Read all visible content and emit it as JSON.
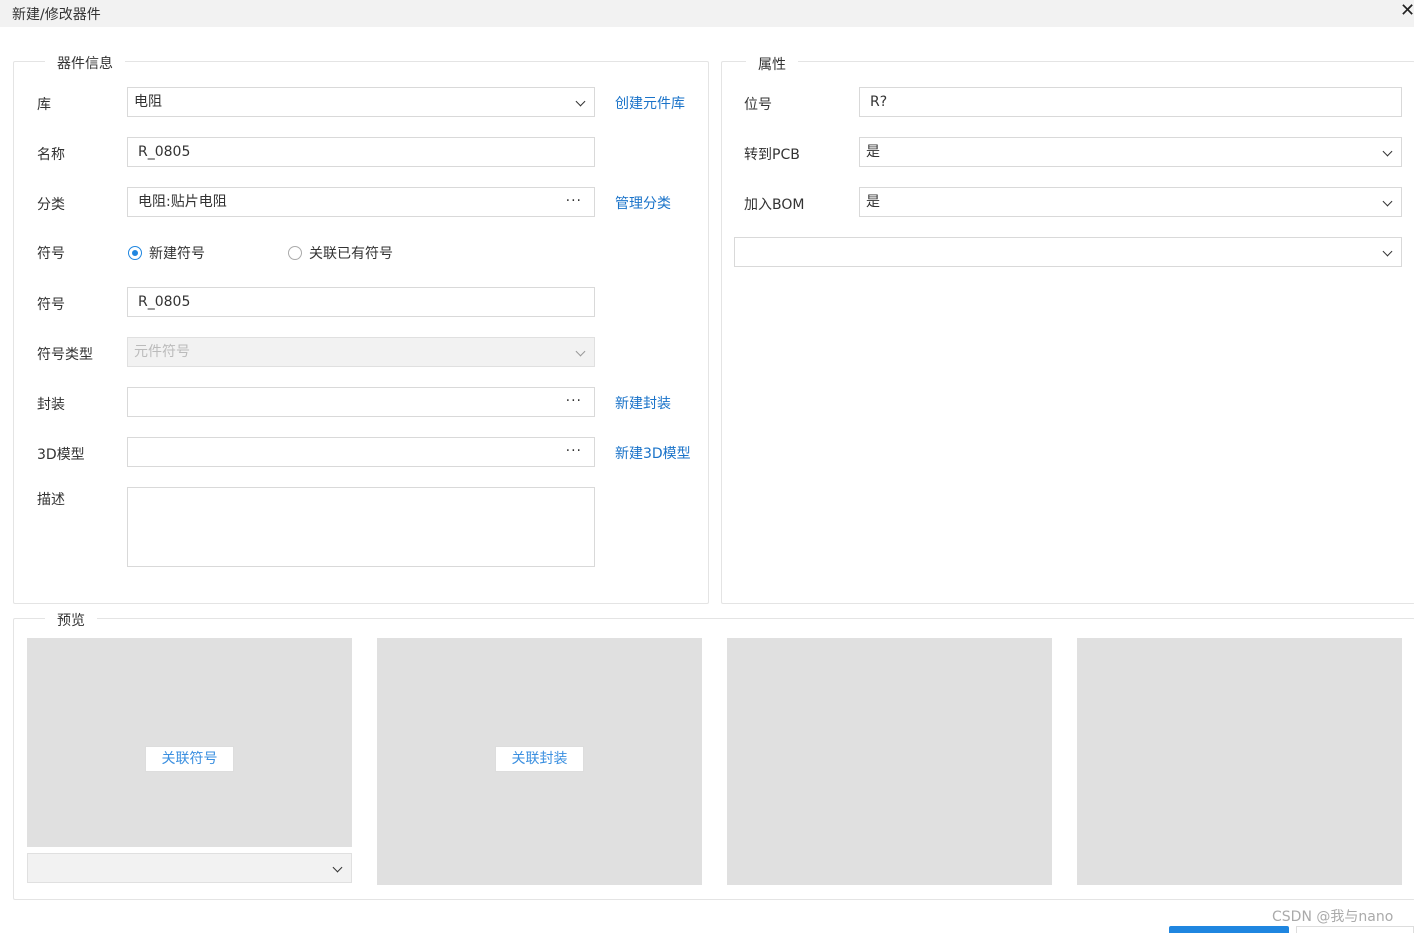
{
  "window": {
    "title": "新建/修改器件",
    "close": "✕"
  },
  "device_info": {
    "legend": "器件信息",
    "library": {
      "label": "库",
      "value": "电阻",
      "link": "创建元件库"
    },
    "name": {
      "label": "名称",
      "value": "R_0805"
    },
    "category": {
      "label": "分类",
      "value": "电阻:贴片电阻",
      "link": "管理分类"
    },
    "symbol_mode": {
      "label": "符号",
      "option_new": "新建符号",
      "option_link": "关联已有符号",
      "selected": "新建符号"
    },
    "symbol": {
      "label": "符号",
      "value": "R_0805"
    },
    "symbol_type": {
      "label": "符号类型",
      "placeholder": "元件符号"
    },
    "footprint": {
      "label": "封装",
      "value": "",
      "link": "新建封装"
    },
    "model3d": {
      "label": "3D模型",
      "value": "",
      "link": "新建3D模型"
    },
    "description": {
      "label": "描述",
      "value": ""
    }
  },
  "properties": {
    "legend": "属性",
    "designator": {
      "label": "位号",
      "value": "R?"
    },
    "to_pcb": {
      "label": "转到PCB",
      "value": "是"
    },
    "add_bom": {
      "label": "加入BOM",
      "value": "是"
    },
    "extra_select": {
      "value": ""
    }
  },
  "preview": {
    "legend": "预览",
    "link_symbol": "关联符号",
    "link_footprint": "关联封装"
  },
  "watermark": "CSDN @我与nano",
  "colors": {
    "accent": "#1f86e0",
    "link": "#1a73c9",
    "preview_bg": "#e0e0e0"
  }
}
